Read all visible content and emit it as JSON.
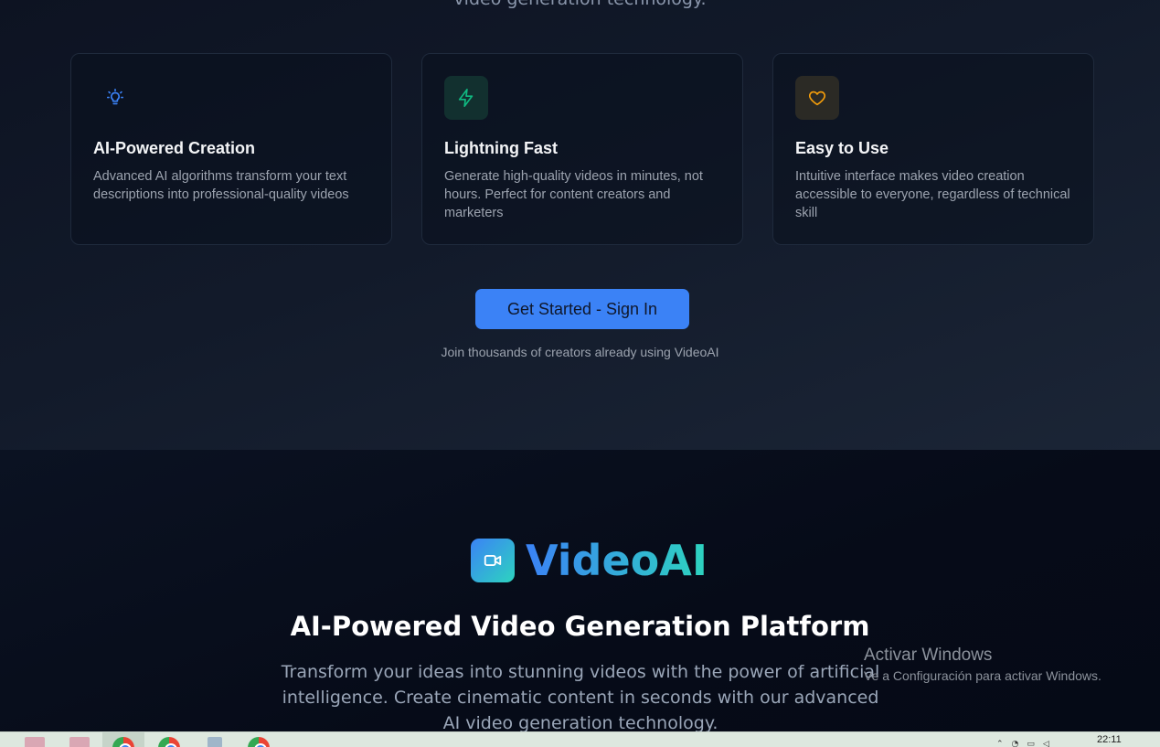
{
  "top": {
    "cut_text": "video generation technology."
  },
  "features": [
    {
      "icon": "lightbulb-icon",
      "title": "AI-Powered Creation",
      "description": "Advanced AI algorithms transform your text descriptions into professional-quality videos",
      "accent": "#3b82f6"
    },
    {
      "icon": "lightning-icon",
      "title": "Lightning Fast",
      "description": "Generate high-quality videos in minutes, not hours. Perfect for content creators and marketers",
      "accent": "#10b981"
    },
    {
      "icon": "heart-icon",
      "title": "Easy to Use",
      "description": "Intuitive interface makes video creation accessible to everyone, regardless of technical skill",
      "accent": "#f59e0b"
    }
  ],
  "cta": {
    "button_label": "Get Started - Sign In",
    "subtext": "Join thousands of creators already using VideoAI"
  },
  "hero": {
    "logo_icon": "video-camera-icon",
    "logo_text": "VideoAI",
    "title": "AI-Powered Video Generation Platform",
    "description": "Transform your ideas into stunning videos with the power of artificial intelligence. Create cinematic content in seconds with our advanced AI video generation technology."
  },
  "watermark": {
    "title": "Activar Windows",
    "subtitle": "Ve a Configuración para activar Windows."
  },
  "taskbar": {
    "time": "22:11"
  },
  "colors": {
    "primary": "#3b82f6",
    "teal": "#2dd4bf",
    "background_dark": "#070d1c"
  }
}
